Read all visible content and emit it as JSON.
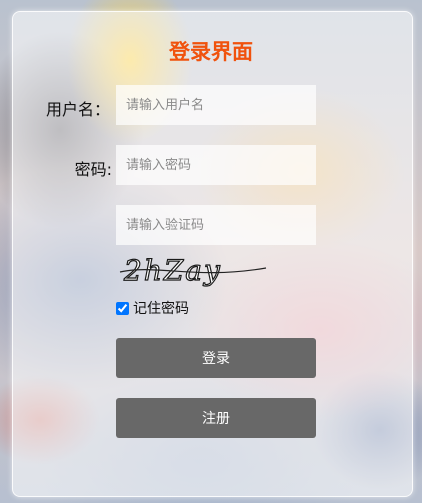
{
  "title": "登录界面",
  "username": {
    "label": "用户名：",
    "placeholder": "请输入用户名",
    "value": ""
  },
  "password": {
    "label": "密码:",
    "placeholder": "请输入密码",
    "value": ""
  },
  "captcha": {
    "placeholder": "请输入验证码",
    "value": "",
    "image_text": "2hZay"
  },
  "remember": {
    "label": "记住密码",
    "checked": true
  },
  "buttons": {
    "login": "登录",
    "register": "注册"
  },
  "colors": {
    "title": "#f0520d",
    "button": "#686868",
    "button_text": "#ffffff"
  }
}
